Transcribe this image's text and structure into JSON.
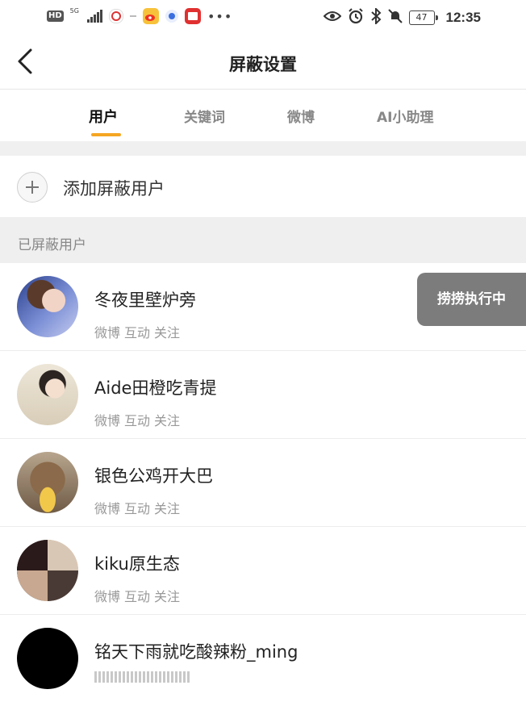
{
  "status_bar": {
    "hd": "HD",
    "network": "5G",
    "battery": "47",
    "time": "12:35",
    "icons_left": [
      "hd-icon",
      "signal-icon",
      "app-icon",
      "weibo-icon",
      "browser-icon",
      "message-icon",
      "more-icon"
    ],
    "icons_right": [
      "eye-icon",
      "alarm-icon",
      "bluetooth-icon",
      "mute-icon",
      "battery-icon"
    ]
  },
  "navbar": {
    "title": "屏蔽设置",
    "back_icon": "chevron-left-icon"
  },
  "tabs": [
    {
      "label": "用户",
      "active": true
    },
    {
      "label": "关键词",
      "active": false
    },
    {
      "label": "微博",
      "active": false
    },
    {
      "label": "AI小助理",
      "active": false
    }
  ],
  "add_user": {
    "label": "添加屏蔽用户",
    "icon": "plus-icon"
  },
  "section": {
    "label": "已屏蔽用户"
  },
  "users": [
    {
      "name": "冬夜里壁炉旁",
      "actions": [
        "微博",
        "互动",
        "关注"
      ]
    },
    {
      "name": "Aide田橙吃青提",
      "actions": [
        "微博",
        "互动",
        "关注"
      ]
    },
    {
      "name": "银色公鸡开大巴",
      "actions": [
        "微博",
        "互动",
        "关注"
      ]
    },
    {
      "name": "kiku原生态",
      "actions": [
        "微博",
        "互动",
        "关注"
      ]
    },
    {
      "name": "铭天下雨就吃酸辣粉_ming",
      "actions": []
    }
  ],
  "toast": {
    "label": "捞捞执行中"
  },
  "colors": {
    "accent": "#f5a623",
    "toast_bg": "#7c7c7c"
  }
}
